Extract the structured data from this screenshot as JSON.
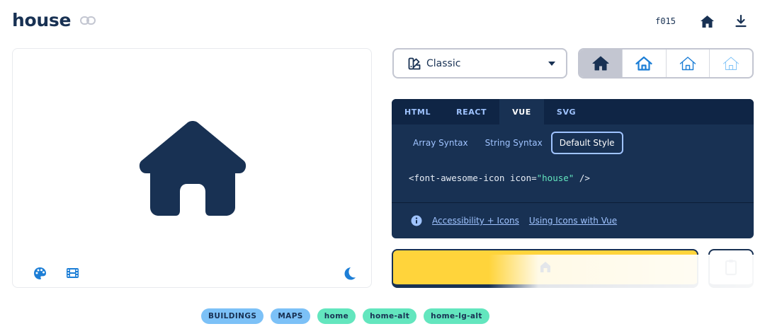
{
  "icon": {
    "name": "house",
    "unicode": "f015"
  },
  "style_select": {
    "selected": "Classic"
  },
  "code": {
    "tabs": [
      "HTML",
      "REACT",
      "VUE",
      "SVG"
    ],
    "active_tab": "VUE",
    "syntax_options": [
      "Array Syntax",
      "String Syntax",
      "Default Style"
    ],
    "active_syntax": "Default Style",
    "snippet_prefix": "<font-awesome-icon icon=",
    "snippet_value": "\"house\"",
    "snippet_suffix": " />",
    "links": [
      "Accessibility + Icons",
      "Using Icons with Vue"
    ]
  },
  "tags": [
    {
      "label": "BUILDINGS",
      "kind": "category"
    },
    {
      "label": "MAPS",
      "kind": "category"
    },
    {
      "label": "home",
      "kind": "alias"
    },
    {
      "label": "home-alt",
      "kind": "alias"
    },
    {
      "label": "home-lg-alt",
      "kind": "alias"
    }
  ],
  "colors": {
    "navy": "#183153",
    "accent_blue": "#1c7ed6",
    "yellow": "#ffd43b",
    "teal": "#63e6be",
    "sky": "#7cc1f7"
  },
  "icons": {
    "link": "link-icon",
    "home_top": "house-icon",
    "download_top": "download-icon",
    "palette": "palette-icon",
    "film": "film-icon",
    "moon": "moon-icon",
    "info": "info-circle-icon",
    "style": "style-swatch-icon",
    "caret": "caret-down-icon"
  }
}
